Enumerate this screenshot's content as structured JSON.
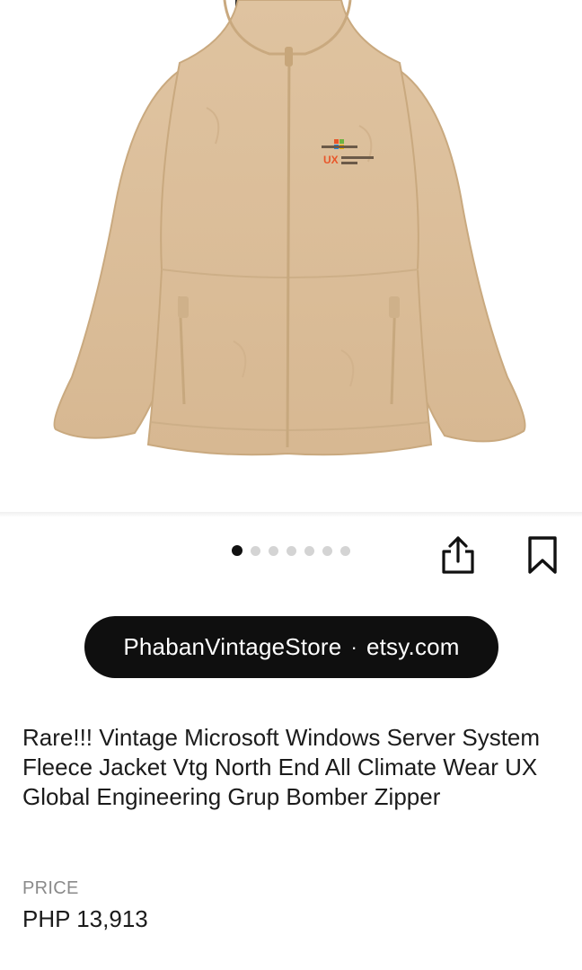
{
  "listing": {
    "image_alt": "tan fleece zip jacket",
    "carousel": {
      "total": 7,
      "active_index": 0
    },
    "logo_text": "UX",
    "store_name": "PhabanVintageStore",
    "separator": "·",
    "store_domain": "etsy.com",
    "title": "Rare!!! Vintage Microsoft Windows Server System Fleece Jacket Vtg North End All Climate Wear UX Global Engineering Grup Bomber Zipper",
    "price_label": "PRICE",
    "price_value": "PHP 13,913"
  },
  "icons": {
    "share": "share-icon",
    "save": "bookmark-icon"
  },
  "colors": {
    "pill_bg": "#0f0f0f",
    "jacket": "#dcbf98",
    "active_dot": "#111111",
    "inactive_dot": "#d4d4d4"
  }
}
